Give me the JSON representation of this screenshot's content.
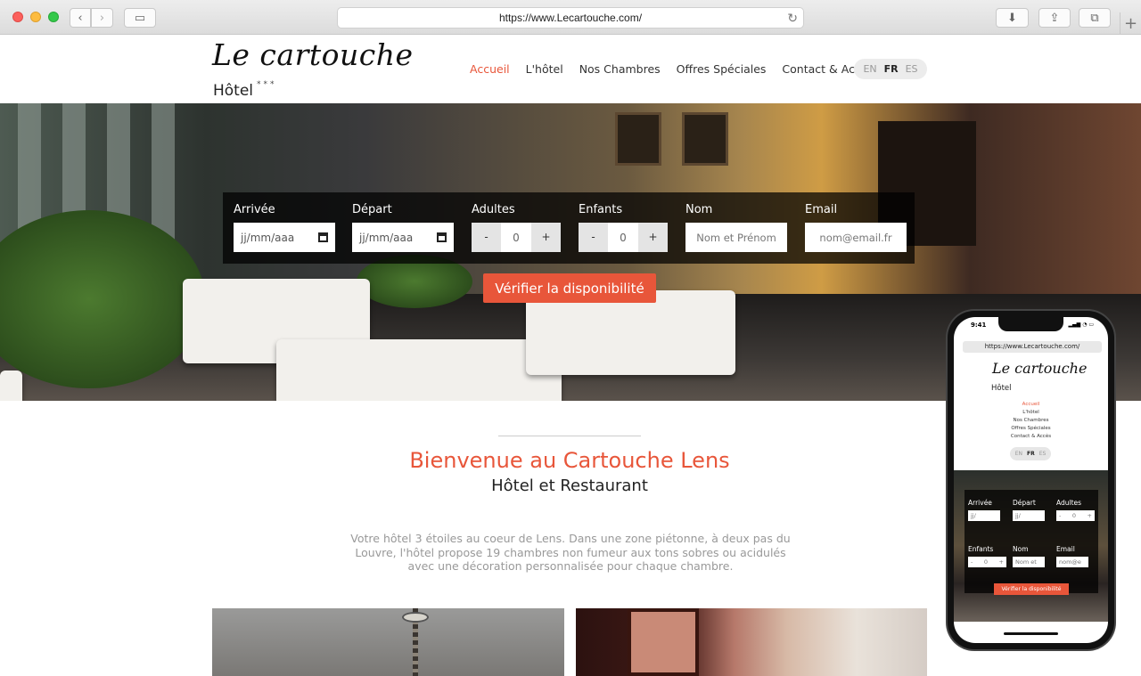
{
  "browser": {
    "url": "https://www.Lecartouche.com/",
    "icons": [
      "back-icon",
      "forward-icon",
      "sidebar-icon",
      "reload-icon",
      "download-icon",
      "share-icon",
      "tabs-icon",
      "new-tab-icon"
    ],
    "back_glyph": "‹",
    "forward_glyph": "›",
    "sidebar_glyph": "▭",
    "reload_glyph": "↻",
    "download_glyph": "⬇",
    "share_glyph": "⇪",
    "tabs_glyph": "⧉",
    "plus_glyph": "+"
  },
  "site": {
    "logo": "Le cartouche",
    "logo_sub": "Hôtel",
    "stars": "***",
    "menu": [
      "Accueil",
      "L'hôtel",
      "Nos Chambres",
      "Offres Spéciales",
      "Contact & Accès"
    ],
    "active_menu": "Accueil",
    "languages": [
      "EN",
      "FR",
      "ES"
    ],
    "current_language": "FR",
    "accent_color": "#e8563a"
  },
  "booking": {
    "arrivee_label": "Arrivée",
    "arrivee_placeholder": "jj/mm/aaa",
    "depart_label": "Départ",
    "depart_placeholder": "jj/mm/aaa",
    "adultes_label": "Adultes",
    "adultes_value": "0",
    "enfants_label": "Enfants",
    "enfants_value": "0",
    "minus": "-",
    "plus": "+",
    "nom_label": "Nom",
    "nom_placeholder": "Nom et Prénom",
    "email_label": "Email",
    "email_placeholder": "nom@email.fr",
    "cta": "Vérifier la disponibilité"
  },
  "welcome": {
    "title": "Bienvenue au Cartouche Lens",
    "subtitle": "Hôtel et Restaurant",
    "text": "Votre hôtel 3 étoiles au coeur de Lens. Dans une zone piétonne, à deux pas du Louvre, l'hôtel propose 19 chambres non fumeur aux tons sobres ou acidulés avec une décoration personnalisée pour chaque chambre."
  },
  "phone": {
    "time": "9:41",
    "status": "▂▄▆ ◔ ▭",
    "url": "https://www.Lecartouche.com/",
    "logo": "Le cartouche",
    "logo_sub": "Hôtel",
    "stars": "***",
    "menu": [
      "Accueil",
      "L'hôtel",
      "Nos Chambres",
      "Offres Spéciales",
      "Contact & Accès"
    ],
    "languages": [
      "EN",
      "FR",
      "ES"
    ],
    "arrivee_label": "Arrivée",
    "depart_label": "Départ",
    "adultes_label": "Adultes",
    "enfants_label": "Enfants",
    "nom_label": "Nom",
    "email_label": "Email",
    "date_placeholder": "jj/",
    "minus": "-",
    "plus": "+",
    "value": "0",
    "nom_placeholder": "Nom et",
    "email_placeholder": "nom@e",
    "cta": "Vérifier la disponibilité"
  }
}
